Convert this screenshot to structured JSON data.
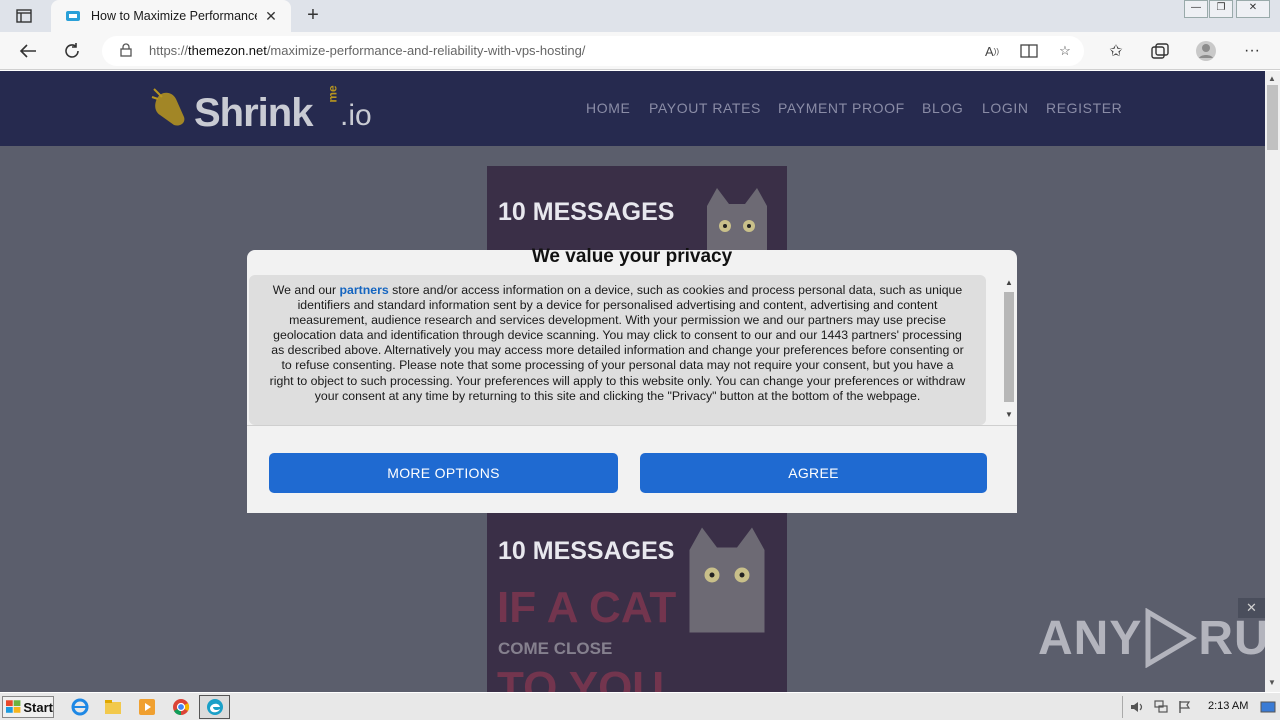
{
  "browser": {
    "tab_title": "How to Maximize Performance",
    "tab_close": "✕",
    "new_tab": "+",
    "url_scheme": "https://",
    "url_host": "themezon.net",
    "url_path": "/maximize-performance-and-reliability-with-vps-hosting/"
  },
  "site": {
    "logo": {
      "text": "Shrink",
      "me": "me",
      "io": ".io"
    },
    "nav": [
      "HOME",
      "PAYOUT RATES",
      "PAYMENT PROOF",
      "BLOG",
      "LOGIN",
      "REGISTER"
    ]
  },
  "ads": {
    "top_headline": "10 MESSAGES",
    "bottom_headline": "10 MESSAGES",
    "bottom_big": "IF A CAT",
    "bottom_small": "COME CLOSE",
    "bottom_big2": "TO YOU"
  },
  "consent": {
    "title": "We value your privacy",
    "body_prefix": "We and our ",
    "partners_link": "partners",
    "body_rest": " store and/or access information on a device, such as cookies and process personal data, such as unique identifiers and standard information sent by a device for personalised advertising and content, advertising and content measurement, audience research and services development. With your permission we and our partners may use precise geolocation data and identification through device scanning. You may click to consent to our and our 1443 partners' processing as described above. Alternatively you may access more detailed information and change your preferences before consenting or to refuse consenting. Please note that some processing of your personal data may not require your consent, but you have a right to object to such processing. Your preferences will apply to this website only. You can change your preferences or withdraw your consent at any time by returning to this site and clicking the \"Privacy\" button at the bottom of the webpage.",
    "more_options": "MORE OPTIONS",
    "agree": "AGREE"
  },
  "watermark": {
    "left": "ANY",
    "right": "RUN"
  },
  "taskbar": {
    "start": "Start",
    "clock": "2:13 AM"
  },
  "colors": {
    "accent": "#1f6ad1",
    "header": "#262a4f",
    "overlay": "#5b5e6c"
  }
}
